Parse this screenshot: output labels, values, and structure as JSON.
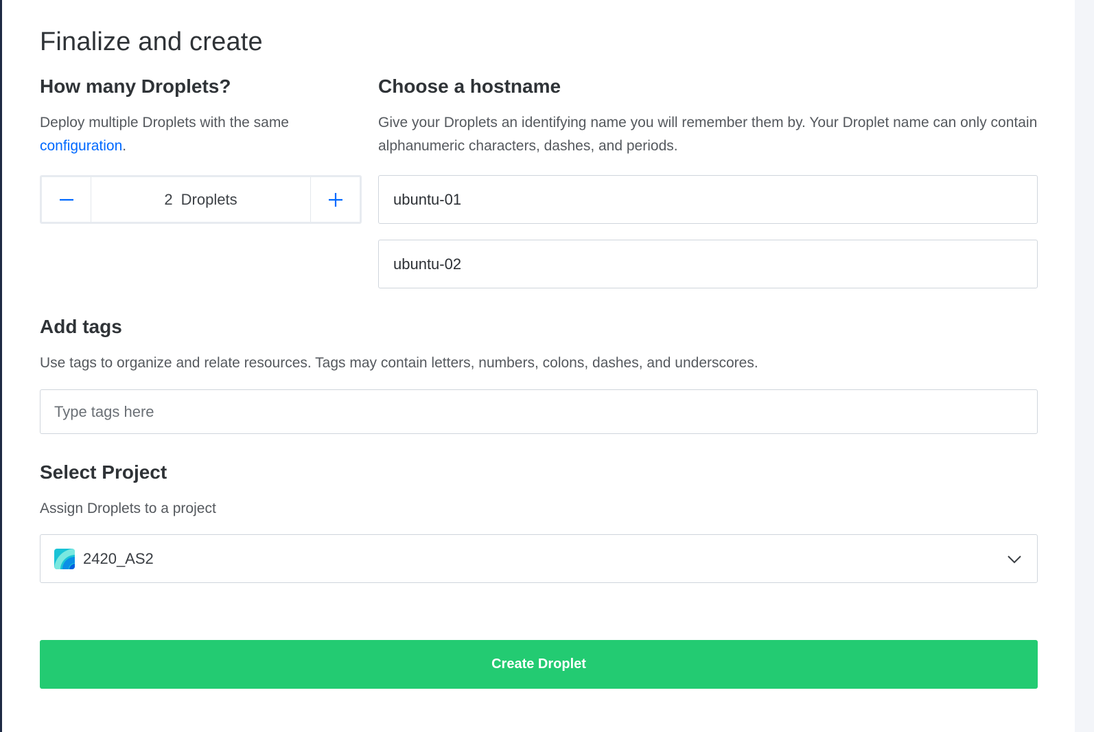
{
  "page": {
    "title": "Finalize and create"
  },
  "droplets": {
    "heading": "How many Droplets?",
    "description_prefix": "Deploy multiple Droplets with the same",
    "description_link": "configuration",
    "description_suffix": ".",
    "minus_symbol": "—",
    "plus_symbol": "+",
    "count": "2",
    "count_unit": "Droplets"
  },
  "hostname": {
    "heading": "Choose a hostname",
    "description": "Give your Droplets an identifying name you will remember them by. Your Droplet name can only contain alphanumeric characters, dashes, and periods.",
    "names": [
      "ubuntu-01",
      "ubuntu-02"
    ]
  },
  "tags": {
    "heading": "Add tags",
    "description": "Use tags to organize and relate resources. Tags may contain letters, numbers, colons, dashes, and underscores.",
    "placeholder": "Type tags here",
    "value": ""
  },
  "project": {
    "heading": "Select Project",
    "description": "Assign Droplets to a project",
    "selected": "2420_AS2",
    "icon": "project-icon",
    "dropdown_icon": "chevron-down-icon"
  },
  "actions": {
    "create_label": "Create Droplet"
  },
  "colors": {
    "accent_blue": "#0069ff",
    "create_green": "#23cb72",
    "left_edge": "#1e2a44"
  }
}
